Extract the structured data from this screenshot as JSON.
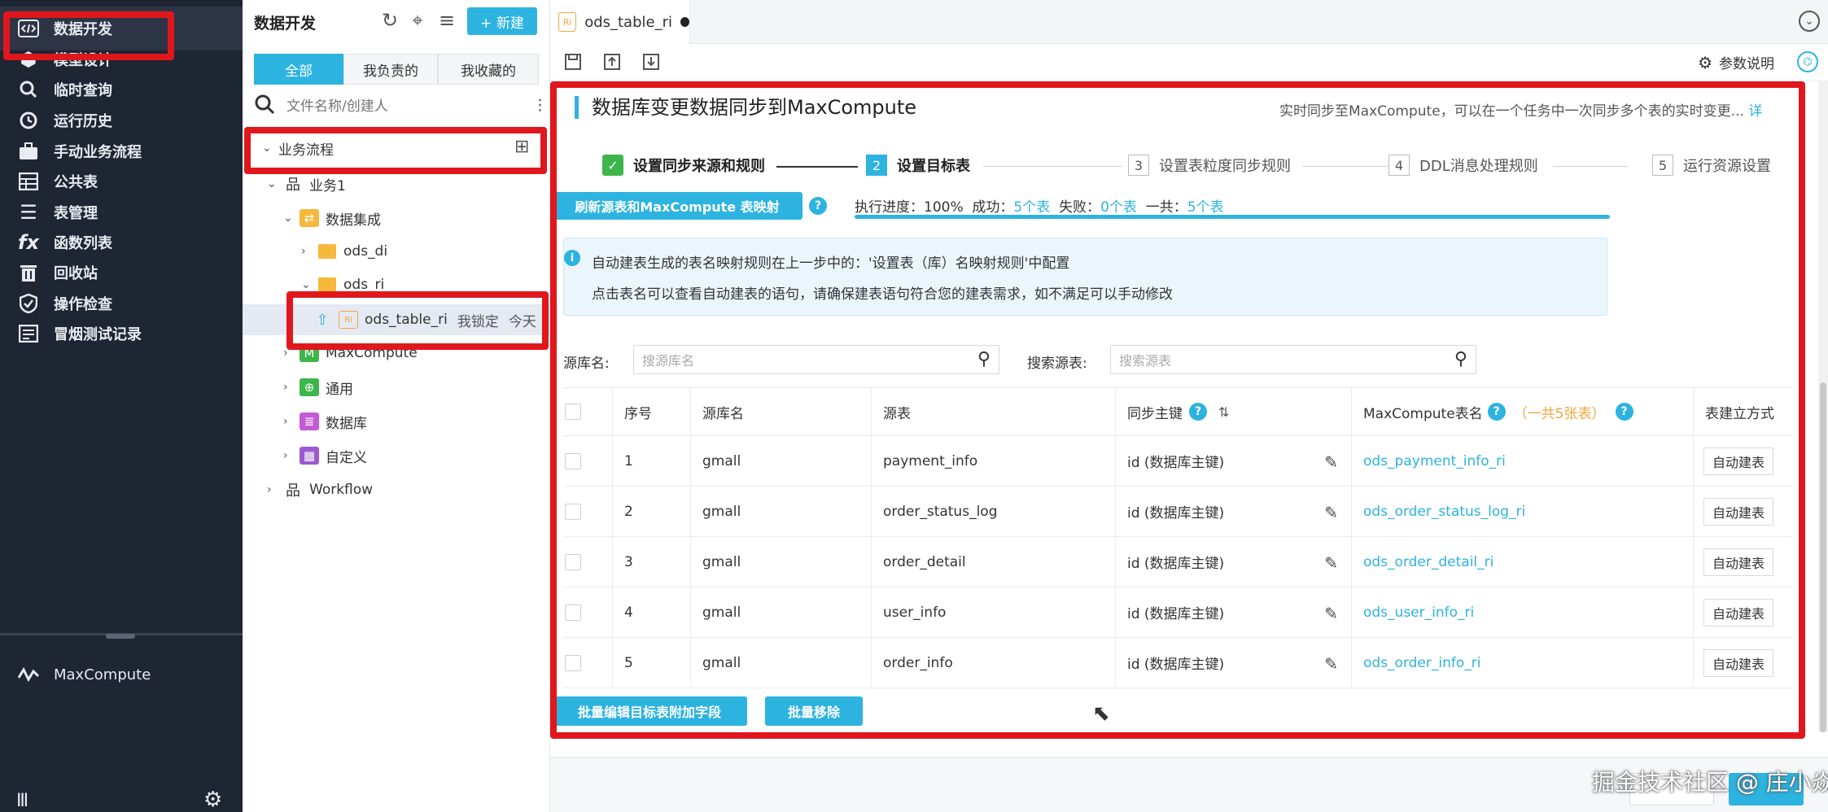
{
  "leftnav": {
    "items": [
      {
        "label": "数据开发",
        "icon": "code-icon"
      },
      {
        "label": "模型设计",
        "icon": "cube-icon"
      },
      {
        "label": "临时查询",
        "icon": "search-icon"
      },
      {
        "label": "运行历史",
        "icon": "clock-icon"
      },
      {
        "label": "手动业务流程",
        "icon": "briefcase-icon"
      },
      {
        "label": "公共表",
        "icon": "table-icon"
      },
      {
        "label": "表管理",
        "icon": "list-icon"
      },
      {
        "label": "函数列表",
        "icon": "fx-icon"
      },
      {
        "label": "回收站",
        "icon": "trash-icon"
      },
      {
        "label": "操作检查",
        "icon": "shield-icon"
      },
      {
        "label": "冒烟测试记录",
        "icon": "record-icon"
      }
    ],
    "engine": "MaxCompute"
  },
  "tree": {
    "title": "数据开发",
    "new_button": "+ 新建",
    "filters": [
      "全部",
      "我负责的",
      "我收藏的"
    ],
    "search_placeholder": "文件名称/创建人",
    "nodes": {
      "business_flow": "业务流程",
      "biz1": "业务1",
      "data_integration": "数据集成",
      "ods_di": "ods_di",
      "ods_ri": "ods_ri",
      "selected_file": "ods_table_ri",
      "selected_lock": "我锁定",
      "selected_time": "今天",
      "maxcompute": "MaxCompute",
      "general": "通用",
      "database": "数据库",
      "custom": "自定义",
      "workflow": "Workflow"
    }
  },
  "tabs": {
    "active": "ods_table_ri",
    "badge": "Ri"
  },
  "toolbar": {
    "params_label": "参数说明"
  },
  "content": {
    "title": "数据库变更数据同步到MaxCompute",
    "description": "实时同步至MaxCompute，可以在一个任务中一次同步多个表的实时变更...",
    "description_link": "详"
  },
  "steps": [
    {
      "num": "✓",
      "label": "设置同步来源和规则",
      "state": "done"
    },
    {
      "num": "2",
      "label": "设置目标表",
      "state": "current"
    },
    {
      "num": "3",
      "label": "设置表粒度同步规则",
      "state": "todo"
    },
    {
      "num": "4",
      "label": "DDL消息处理规则",
      "state": "todo"
    },
    {
      "num": "5",
      "label": "运行资源设置",
      "state": "todo"
    }
  ],
  "refresh": {
    "button": "刷新源表和MaxCompute 表映射",
    "progress_label": "执行进度：100%",
    "success_label": "成功：",
    "success_value": "5个表",
    "fail_label": "失败：",
    "fail_value": "0个表",
    "total_label": "一共：",
    "total_value": "5个表",
    "progress": 1.0
  },
  "info": {
    "line1": "自动建表生成的表名映射规则在上一步中的：'设置表（库）名映射规则'中配置",
    "line2": "点击表名可以查看自动建表的语句，请确保建表语句符合您的建表需求，如不满足可以手动修改"
  },
  "filters": {
    "source_db_label": "源库名:",
    "source_db_placeholder": "搜源库名",
    "source_table_label": "搜索源表:",
    "source_table_placeholder": "搜索源表"
  },
  "table": {
    "headers": {
      "index": "序号",
      "db": "源库名",
      "source": "源表",
      "pk": "同步主键",
      "target": "MaxCompute表名",
      "target_count": "（一共5张表）",
      "mode": "表建立方式"
    },
    "rows": [
      {
        "index": "1",
        "db": "gmall",
        "source": "payment_info",
        "pk": "id (数据库主键)",
        "target": "ods_payment_info_ri",
        "mode": "自动建表"
      },
      {
        "index": "2",
        "db": "gmall",
        "source": "order_status_log",
        "pk": "id (数据库主键)",
        "target": "ods_order_status_log_ri",
        "mode": "自动建表"
      },
      {
        "index": "3",
        "db": "gmall",
        "source": "order_detail",
        "pk": "id (数据库主键)",
        "target": "ods_order_detail_ri",
        "mode": "自动建表"
      },
      {
        "index": "4",
        "db": "gmall",
        "source": "user_info",
        "pk": "id (数据库主键)",
        "target": "ods_user_info_ri",
        "mode": "自动建表"
      },
      {
        "index": "5",
        "db": "gmall",
        "source": "order_info",
        "pk": "id (数据库主键)",
        "target": "ods_order_info_ri",
        "mode": "自动建表"
      }
    ]
  },
  "bottom": {
    "batch_edit": "批量编辑目标表附加字段",
    "batch_remove": "批量移除"
  },
  "watermark": "掘金技术社区 @ 庄小焱",
  "colors": {
    "accent": "#2db3e0",
    "highlight": "#e0171c",
    "sidebar": "#1e2533",
    "success": "#3cb54a"
  }
}
